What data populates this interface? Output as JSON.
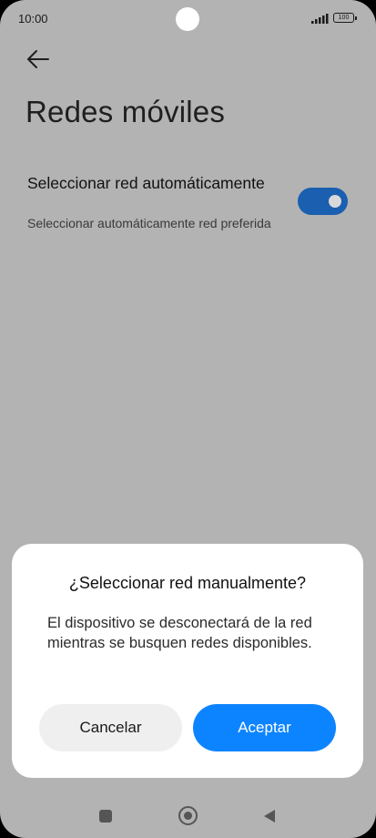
{
  "status_bar": {
    "time": "10:00",
    "battery": "100",
    "icons": [
      "signal-icon",
      "battery-icon",
      "camera-cutout"
    ]
  },
  "header": {
    "back_icon": "arrow-left-icon",
    "title": "Redes móviles"
  },
  "setting": {
    "title": "Seleccionar red automáticamente",
    "description": "Seleccionar automáticamente red preferida",
    "toggle_on": true
  },
  "dialog": {
    "title": "¿Seleccionar red manualmente?",
    "message": "El dispositivo se desconectará de la red mientras se busquen redes disponibles.",
    "cancel_label": "Cancelar",
    "accept_label": "Aceptar"
  },
  "nav_bar": {
    "icons": [
      "recents-square-icon",
      "home-circle-icon",
      "back-triangle-icon"
    ]
  },
  "colors": {
    "scrim": "#b3b3b3",
    "toggle_on": "#1a5fb0",
    "accent": "#0d84ff",
    "cancel_bg": "#efefef"
  }
}
